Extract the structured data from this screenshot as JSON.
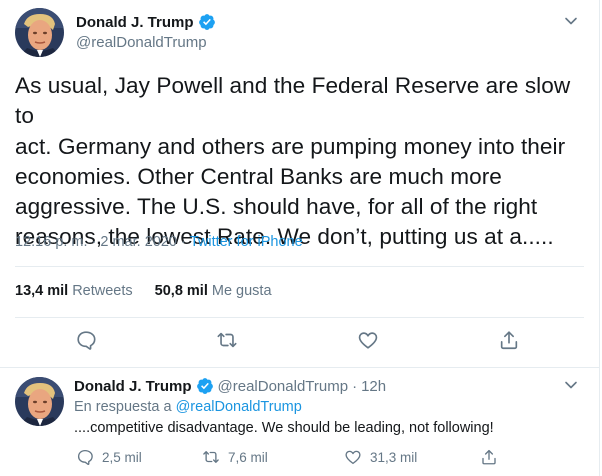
{
  "main_tweet": {
    "name": "Donald J. Trump",
    "handle": "@realDonaldTrump",
    "text_lines": [
      "As usual, Jay Powell and the Federal Reserve are slow to",
      "act. Germany and others are pumping money into their",
      "economies. Other Central Banks are much more",
      "aggressive. The U.S. should have, for all of the right",
      "reasons, the lowest Rate. We don’t, putting us at a....."
    ],
    "time": "12:16 p. m.",
    "separator": "·",
    "date": "2 mar. 2020",
    "source": "Twitter for iPhone",
    "retweets_count": "13,4 mil",
    "retweets_label": "Retweets",
    "likes_count": "50,8 mil",
    "likes_label": "Me gusta"
  },
  "reply_tweet": {
    "name": "Donald J. Trump",
    "handle": "@realDonaldTrump",
    "dot": "·",
    "time": "12h",
    "reply_prefix": "En respuesta a",
    "reply_to": "@realDonaldTrump",
    "text": "....competitive disadvantage. We should be leading, not following!",
    "replies_count": "2,5 mil",
    "retweets_count": "7,6 mil",
    "likes_count": "31,3 mil"
  },
  "icons": {
    "verified": "verified-badge-icon",
    "caret": "chevron-down-icon",
    "reply": "reply-icon",
    "retweet": "retweet-icon",
    "like": "heart-icon",
    "share": "share-icon"
  },
  "colors": {
    "text": "#14171a",
    "secondary": "#657786",
    "link": "#1b95e0",
    "verified": "#1da1f2",
    "divider": "#e6ecf0"
  }
}
